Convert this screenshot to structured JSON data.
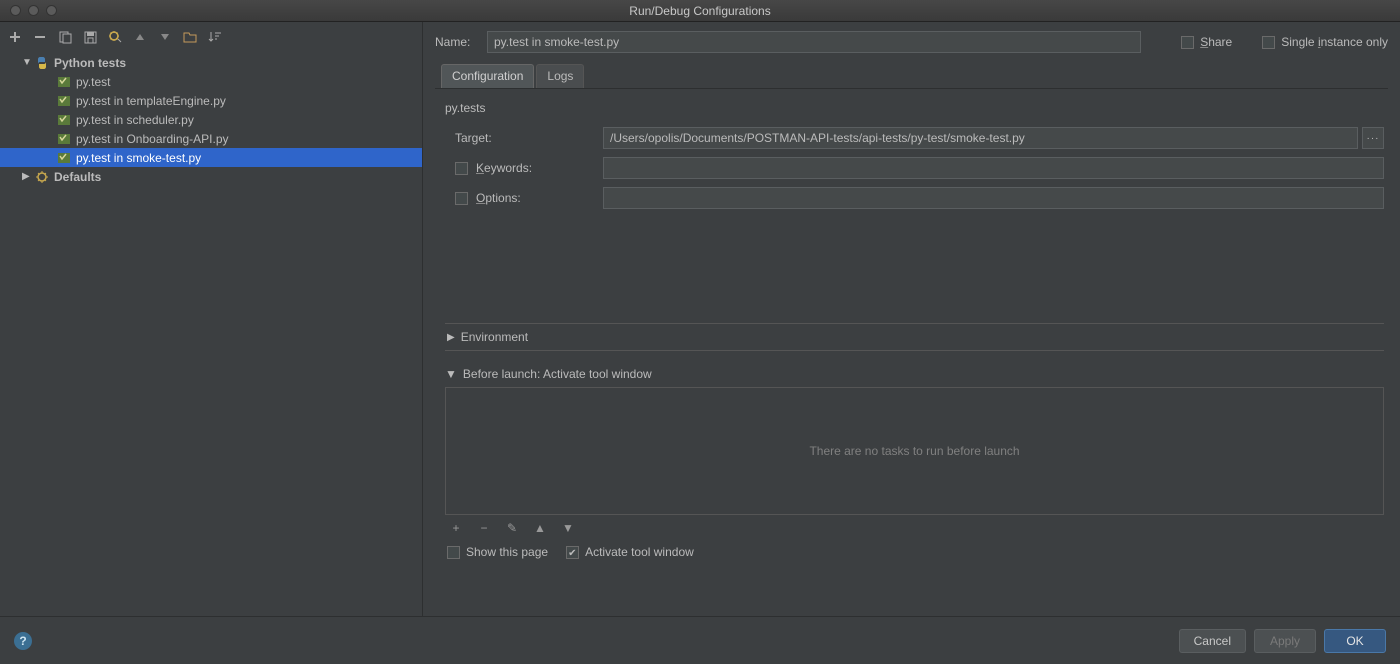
{
  "window": {
    "title": "Run/Debug Configurations"
  },
  "toolbar": {
    "add": "+",
    "remove": "−",
    "copy": "copy",
    "save": "save",
    "settings": "settings",
    "up": "▲",
    "down": "▼",
    "folder": "folder",
    "sort": "sort"
  },
  "tree": {
    "root": {
      "label": "Python tests",
      "expanded": true
    },
    "items": [
      {
        "label": "py.test"
      },
      {
        "label": "py.test in templateEngine.py"
      },
      {
        "label": "py.test in scheduler.py"
      },
      {
        "label": "py.test in Onboarding-API.py"
      },
      {
        "label": "py.test in smoke-test.py",
        "selected": true
      }
    ],
    "defaults": {
      "label": "Defaults",
      "expanded": false
    }
  },
  "form": {
    "name_label": "Name:",
    "name_value": "py.test in smoke-test.py",
    "share_label": "Share",
    "single_label": "Single instance only",
    "tabs": {
      "config": "Configuration",
      "logs": "Logs"
    },
    "section_title": "py.tests",
    "target_label": "Target:",
    "target_value": "/Users/opolis/Documents/POSTMAN-API-tests/api-tests/py-test/smoke-test.py",
    "keywords_label": "Keywords:",
    "keywords_value": "",
    "options_label": "Options:",
    "options_value": "",
    "env_label": "Environment",
    "before_label": "Before launch: Activate tool window",
    "no_tasks": "There are no tasks to run before launch",
    "show_page": "Show this page",
    "activate_tool": "Activate tool window"
  },
  "footer": {
    "cancel": "Cancel",
    "apply": "Apply",
    "ok": "OK"
  }
}
